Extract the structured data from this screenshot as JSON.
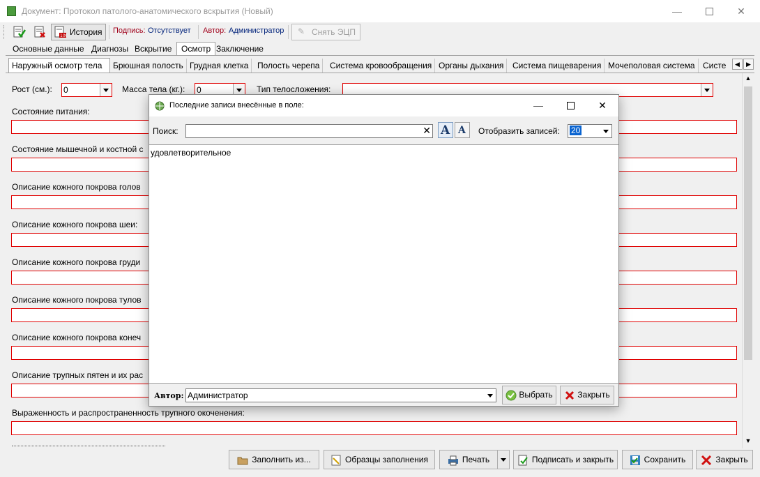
{
  "window": {
    "title": "Документ: Протокол патолого-анатомического вскрытия (Новый)"
  },
  "toolbar": {
    "history_label": "История",
    "signature_label": "Подпись:",
    "signature_value": "Отсутствует",
    "author_label": "Автор:",
    "author_value": "Администратор",
    "remove_eds_label": "Снять ЭЦП"
  },
  "tabs_top": [
    "Основные данные",
    "Диагнозы",
    "Вскрытие",
    "Осмотр",
    "Заключение"
  ],
  "tabs_top_active": "Осмотр",
  "tabs_sub": [
    "Наружный осмотр тела",
    "Брюшная полость",
    "Грудная клетка",
    "Полость черепа",
    "Система кровообращения",
    "Органы дыхания",
    "Система пищеварения",
    "Мочеполовая система",
    "Систе"
  ],
  "tabs_sub_active": "Наружный осмотр тела",
  "form": {
    "height_label": "Рост (см.):",
    "height_value": "0",
    "weight_label": "Масса тела (кг.):",
    "weight_value": "0",
    "body_type_label": "Тип телосложения:",
    "body_type_value": "",
    "fields": [
      "Состояние питания:",
      "Состояние мышечной и костной с",
      "Описание кожного покрова голов",
      "Описание кожного покрова шеи:",
      "Описание кожного покрова груди",
      "Описание кожного покрова тулов",
      "Описание кожного покрова конеч",
      "Описание трупных пятен и их рас",
      "Выраженность и распространенность трупного окоченения:"
    ]
  },
  "bottom_buttons": {
    "fill_from": "Заполнить из...",
    "samples": "Образцы заполнения",
    "print": "Печать",
    "sign_close": "Подписать и закрыть",
    "save": "Сохранить",
    "close": "Закрыть"
  },
  "dialog": {
    "title": "Последние записи внесённые в поле:",
    "search_label": "Поиск:",
    "search_value": "",
    "show_records_label": "Отобразить записей:",
    "show_records_value": "20",
    "records": [
      "удовлетворительное"
    ],
    "author_label": "Автор:",
    "author_value": "Администратор",
    "select_button": "Выбрать",
    "close_button": "Закрыть"
  }
}
